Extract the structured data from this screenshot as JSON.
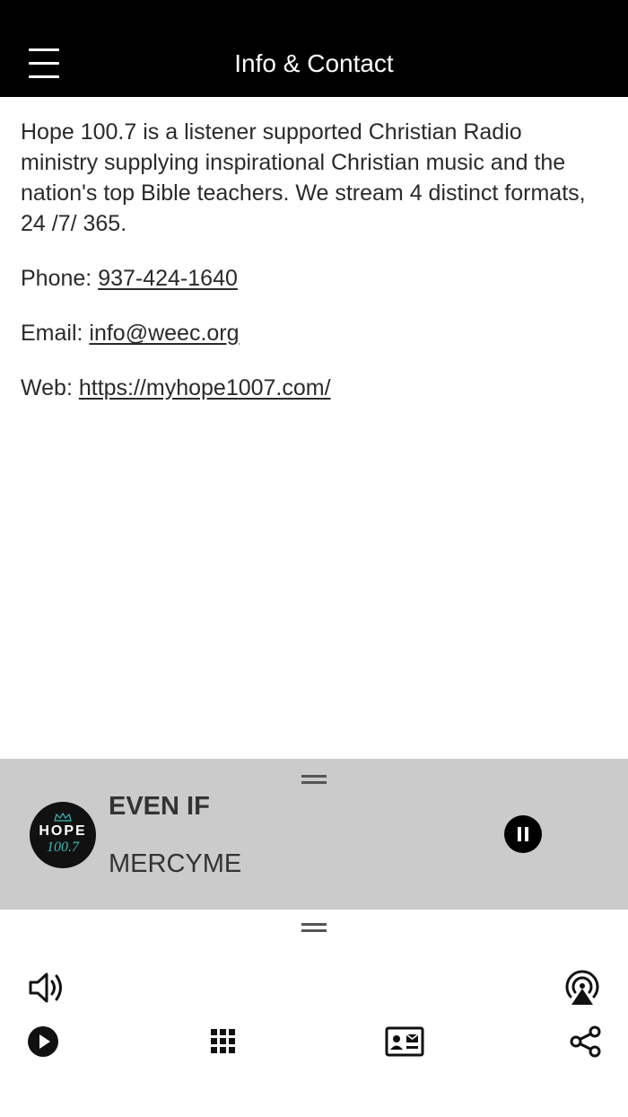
{
  "header": {
    "title": "Info & Contact",
    "menu_icon": "hamburger-menu-icon"
  },
  "content": {
    "description": "Hope 100.7 is a listener supported Christian Radio ministry supplying inspirational Christian music and the nation's top Bible teachers. We stream 4 distinct formats, 24 /7/ 365.",
    "phone_label": "Phone: ",
    "phone": "937-424-1640",
    "email_label": "Email: ",
    "email": "info@weec.org",
    "web_label": "Web: ",
    "web": "https://myhope1007.com/"
  },
  "player": {
    "logo_line1": "HOPE",
    "logo_line2": "100.7",
    "song_title": "EVEN IF",
    "artist": "MERCYME",
    "panel_color": "#cbcbcb",
    "pause_icon": "pause-icon"
  },
  "toolbar": {
    "icons": [
      "volume-icon",
      "airplay-icon",
      "play-icon",
      "grid-icon",
      "contact-card-icon",
      "share-icon"
    ]
  }
}
